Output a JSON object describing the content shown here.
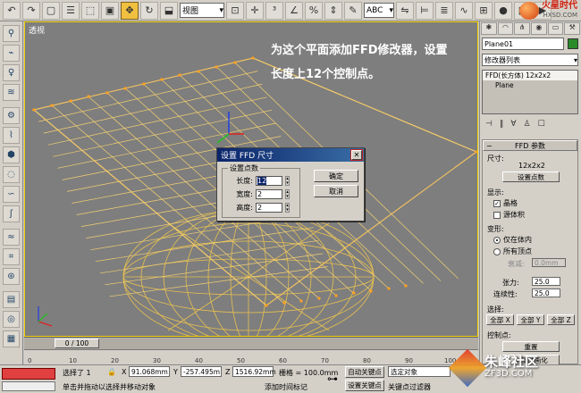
{
  "toolbar": {
    "view_select": "视图",
    "icons": [
      "undo-icon",
      "redo-icon",
      "select-icon",
      "select-region-icon",
      "select-window-icon",
      "move-icon",
      "rotate-icon",
      "scale-icon",
      "view-dropdown",
      "pivot-icon",
      "select-manip-icon",
      "snap-3d-icon",
      "angle-snap-icon",
      "percent-snap-icon",
      "spinner-snap-icon",
      "named-sel-dropdown",
      "mirror-icon",
      "align-icon",
      "layers-icon",
      "curve-editor-icon",
      "schematic-icon",
      "material-icon",
      "render-setup-icon",
      "quick-render-icon",
      "render-type-dropdown",
      "render-icon"
    ],
    "render_select": "ABC"
  },
  "logo": {
    "title": "火星时代",
    "subtitle": "HXSD.COM"
  },
  "viewport": {
    "label": "透视",
    "instruction_line1": "为这个平面添加FFD修改器，设置",
    "instruction_line2": "长度上12个控制点。"
  },
  "dialog": {
    "title": "设置 FFD 尺寸",
    "group_label": "设置点数",
    "length_label": "长度:",
    "length_value": "12",
    "width_label": "宽度:",
    "width_value": "2",
    "height_label": "高度:",
    "height_value": "2",
    "ok_label": "确定",
    "cancel_label": "取消"
  },
  "command_panel": {
    "object_name": "Plane01",
    "object_color": "#2a8a2a",
    "modifier_list": "修改器列表",
    "stack": [
      "FFD(长方体) 12x2x2",
      "Plane"
    ],
    "rollout_title": "FFD 参数",
    "size_label": "尺寸:",
    "size_value": "12x2x2",
    "set_points_button": "设置点数",
    "display_label": "显示:",
    "lattice_label": "晶格",
    "source_volume_label": "源体积",
    "deform_label": "变形:",
    "only_in_volume_label": "仅在体内",
    "all_vertices_label": "所有顶点",
    "falloff_label": "衰减:",
    "falloff_value": "0.0mm",
    "tension_label": "张力:",
    "tension_value": "25.0",
    "continuity_label": "连续性:",
    "continuity_value": "25.0",
    "select_label": "选择:",
    "all_x": "全部 X",
    "all_y": "全部 Y",
    "all_z": "全部 Z",
    "control_points_label": "控制点:",
    "reset_button": "重置",
    "animate_all_button": "全部动画化"
  },
  "timeline": {
    "slider": "0 / 100",
    "ticks": [
      "0",
      "10",
      "20",
      "30",
      "40",
      "50",
      "60",
      "70",
      "80",
      "90",
      "100"
    ]
  },
  "status": {
    "selected": "选择了 1",
    "x_label": "X",
    "x_value": "91.068mm",
    "y_label": "Y",
    "y_value": "-257.495m",
    "z_label": "Z",
    "z_value": "1516.92mm",
    "grid": "栅格 = 100.0mm",
    "hint": "单击并拖动以选择并移动对象",
    "add_time_tag": "添加时间标记",
    "auto_key": "自动关键点",
    "set_key": "设置关键点",
    "selected_dropdown": "选定对象",
    "key_filters": "关键点过滤器"
  },
  "watermark": {
    "title": "朱峰社区",
    "subtitle": "ZF3D.COM"
  }
}
